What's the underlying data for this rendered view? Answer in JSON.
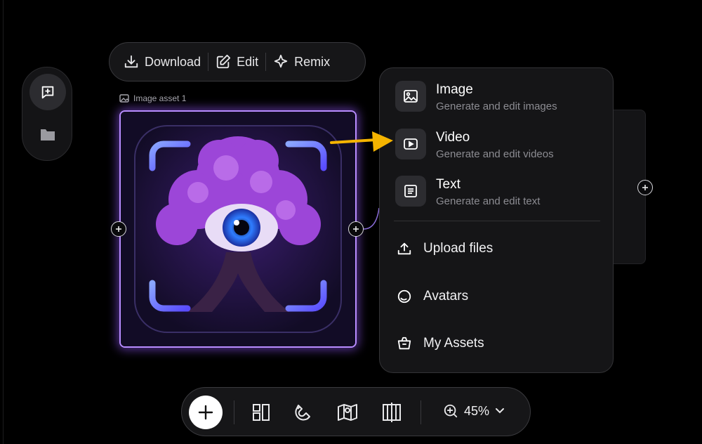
{
  "toolbar": {
    "download_label": "Download",
    "edit_label": "Edit",
    "remix_label": "Remix"
  },
  "asset": {
    "label": "Image asset 1"
  },
  "menu": {
    "generators": [
      {
        "title": "Image",
        "desc": "Generate and edit images",
        "icon": "image-icon"
      },
      {
        "title": "Video",
        "desc": "Generate and edit videos",
        "icon": "video-icon"
      },
      {
        "title": "Text",
        "desc": "Generate and edit text",
        "icon": "text-icon"
      }
    ],
    "items": [
      {
        "label": "Upload files",
        "icon": "upload-icon"
      },
      {
        "label": "Avatars",
        "icon": "avatar-icon"
      },
      {
        "label": "My Assets",
        "icon": "basket-icon"
      }
    ]
  },
  "bottom": {
    "zoom": "45%"
  },
  "colors": {
    "accent_purple": "#b88cff",
    "annotation_arrow": "#f5b400"
  }
}
